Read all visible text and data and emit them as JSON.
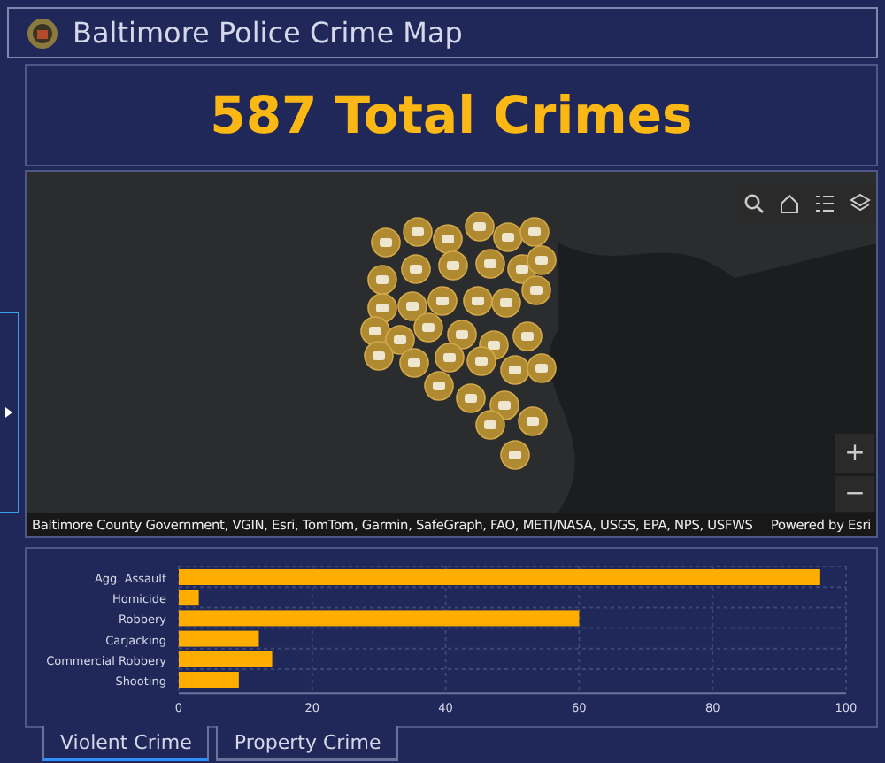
{
  "header": {
    "title": "Baltimore Police Crime Map"
  },
  "total": {
    "text": "587 Total Crimes"
  },
  "map": {
    "attribution": "Baltimore County Government, VGIN, Esri, TomTom, Garmin, SafeGraph, FAO, METI/NASA, USGS, EPA, NPS, USFWS",
    "powered_by": "Powered by Esri",
    "zoom_in": "+",
    "zoom_out": "−"
  },
  "chart": {
    "chart_data": {
      "type": "bar",
      "orientation": "horizontal",
      "categories": [
        "Agg. Assault",
        "Homicide",
        "Robbery",
        "Carjacking",
        "Commercial Robbery",
        "Shooting"
      ],
      "values": [
        96,
        3,
        60,
        12,
        14,
        9
      ],
      "xlim": [
        0,
        100
      ],
      "xticks": [
        0,
        20,
        40,
        60,
        80,
        100
      ],
      "grid": true
    }
  },
  "tabs": [
    {
      "label": "Violent Crime",
      "selected": true
    },
    {
      "label": "Property Crime",
      "selected": false
    }
  ]
}
